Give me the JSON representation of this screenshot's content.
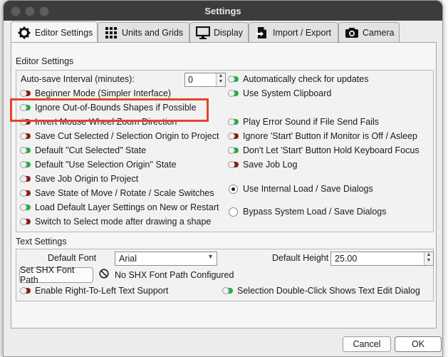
{
  "window": {
    "title": "Settings"
  },
  "tabs": [
    {
      "label": "Editor Settings",
      "icon": "gear-icon"
    },
    {
      "label": "Units and Grids",
      "icon": "grid-icon"
    },
    {
      "label": "Display",
      "icon": "monitor-icon"
    },
    {
      "label": "Import / Export",
      "icon": "import-export-icon"
    },
    {
      "label": "Camera",
      "icon": "camera-icon"
    }
  ],
  "editor": {
    "section_title": "Editor Settings",
    "autosave_label": "Auto-save Interval (minutes):",
    "autosave_value": "0",
    "left": [
      {
        "label": "Beginner Mode (Simpler Interface)",
        "state": "off"
      },
      {
        "label": "Ignore Out-of-Bounds Shapes if Possible",
        "state": "on"
      },
      {
        "label": "Invert Mouse Wheel Zoom Direction",
        "state": "off"
      },
      {
        "label": "Save Cut Selected / Selection Origin to Project",
        "state": "off"
      },
      {
        "label": "Default \"Cut Selected\" State",
        "state": "on"
      },
      {
        "label": "Default \"Use Selection Origin\" State",
        "state": "on"
      },
      {
        "label": "Save Job Origin to Project",
        "state": "off"
      },
      {
        "label": "Save State of Move / Rotate / Scale Switches",
        "state": "off"
      },
      {
        "label": "Load Default Layer Settings on New or Restart",
        "state": "on"
      },
      {
        "label": "Switch to Select mode after drawing a shape",
        "state": "off"
      }
    ],
    "right": [
      {
        "label": "Automatically check for updates",
        "state": "on"
      },
      {
        "label": "Use System Clipboard",
        "state": "on"
      },
      {
        "label": "Play Error Sound if File Send Fails",
        "state": "on"
      },
      {
        "label": "Ignore 'Start' Button if Monitor is Off / Asleep",
        "state": "off"
      },
      {
        "label": "Don't Let 'Start' Button Hold Keyboard Focus",
        "state": "on"
      },
      {
        "label": "Save Job Log",
        "state": "off"
      }
    ],
    "dialogs": [
      {
        "label": "Use Internal Load / Save Dialogs",
        "checked": true
      },
      {
        "label": "Bypass System Load / Save Dialogs",
        "checked": false
      }
    ]
  },
  "text": {
    "section_title": "Text Settings",
    "default_font_label": "Default Font",
    "default_font_value": "Arial",
    "default_height_label": "Default Height",
    "default_height_value": "25.00",
    "shx_button": "Set SHX Font Path",
    "shx_status": "No SHX Font Path Configured",
    "rtl": {
      "label": "Enable Right-To-Left Text Support",
      "state": "off"
    },
    "dblclick": {
      "label": "Selection Double-Click Shows Text Edit Dialog",
      "state": "on"
    }
  },
  "footer": {
    "cancel": "Cancel",
    "ok": "OK"
  }
}
